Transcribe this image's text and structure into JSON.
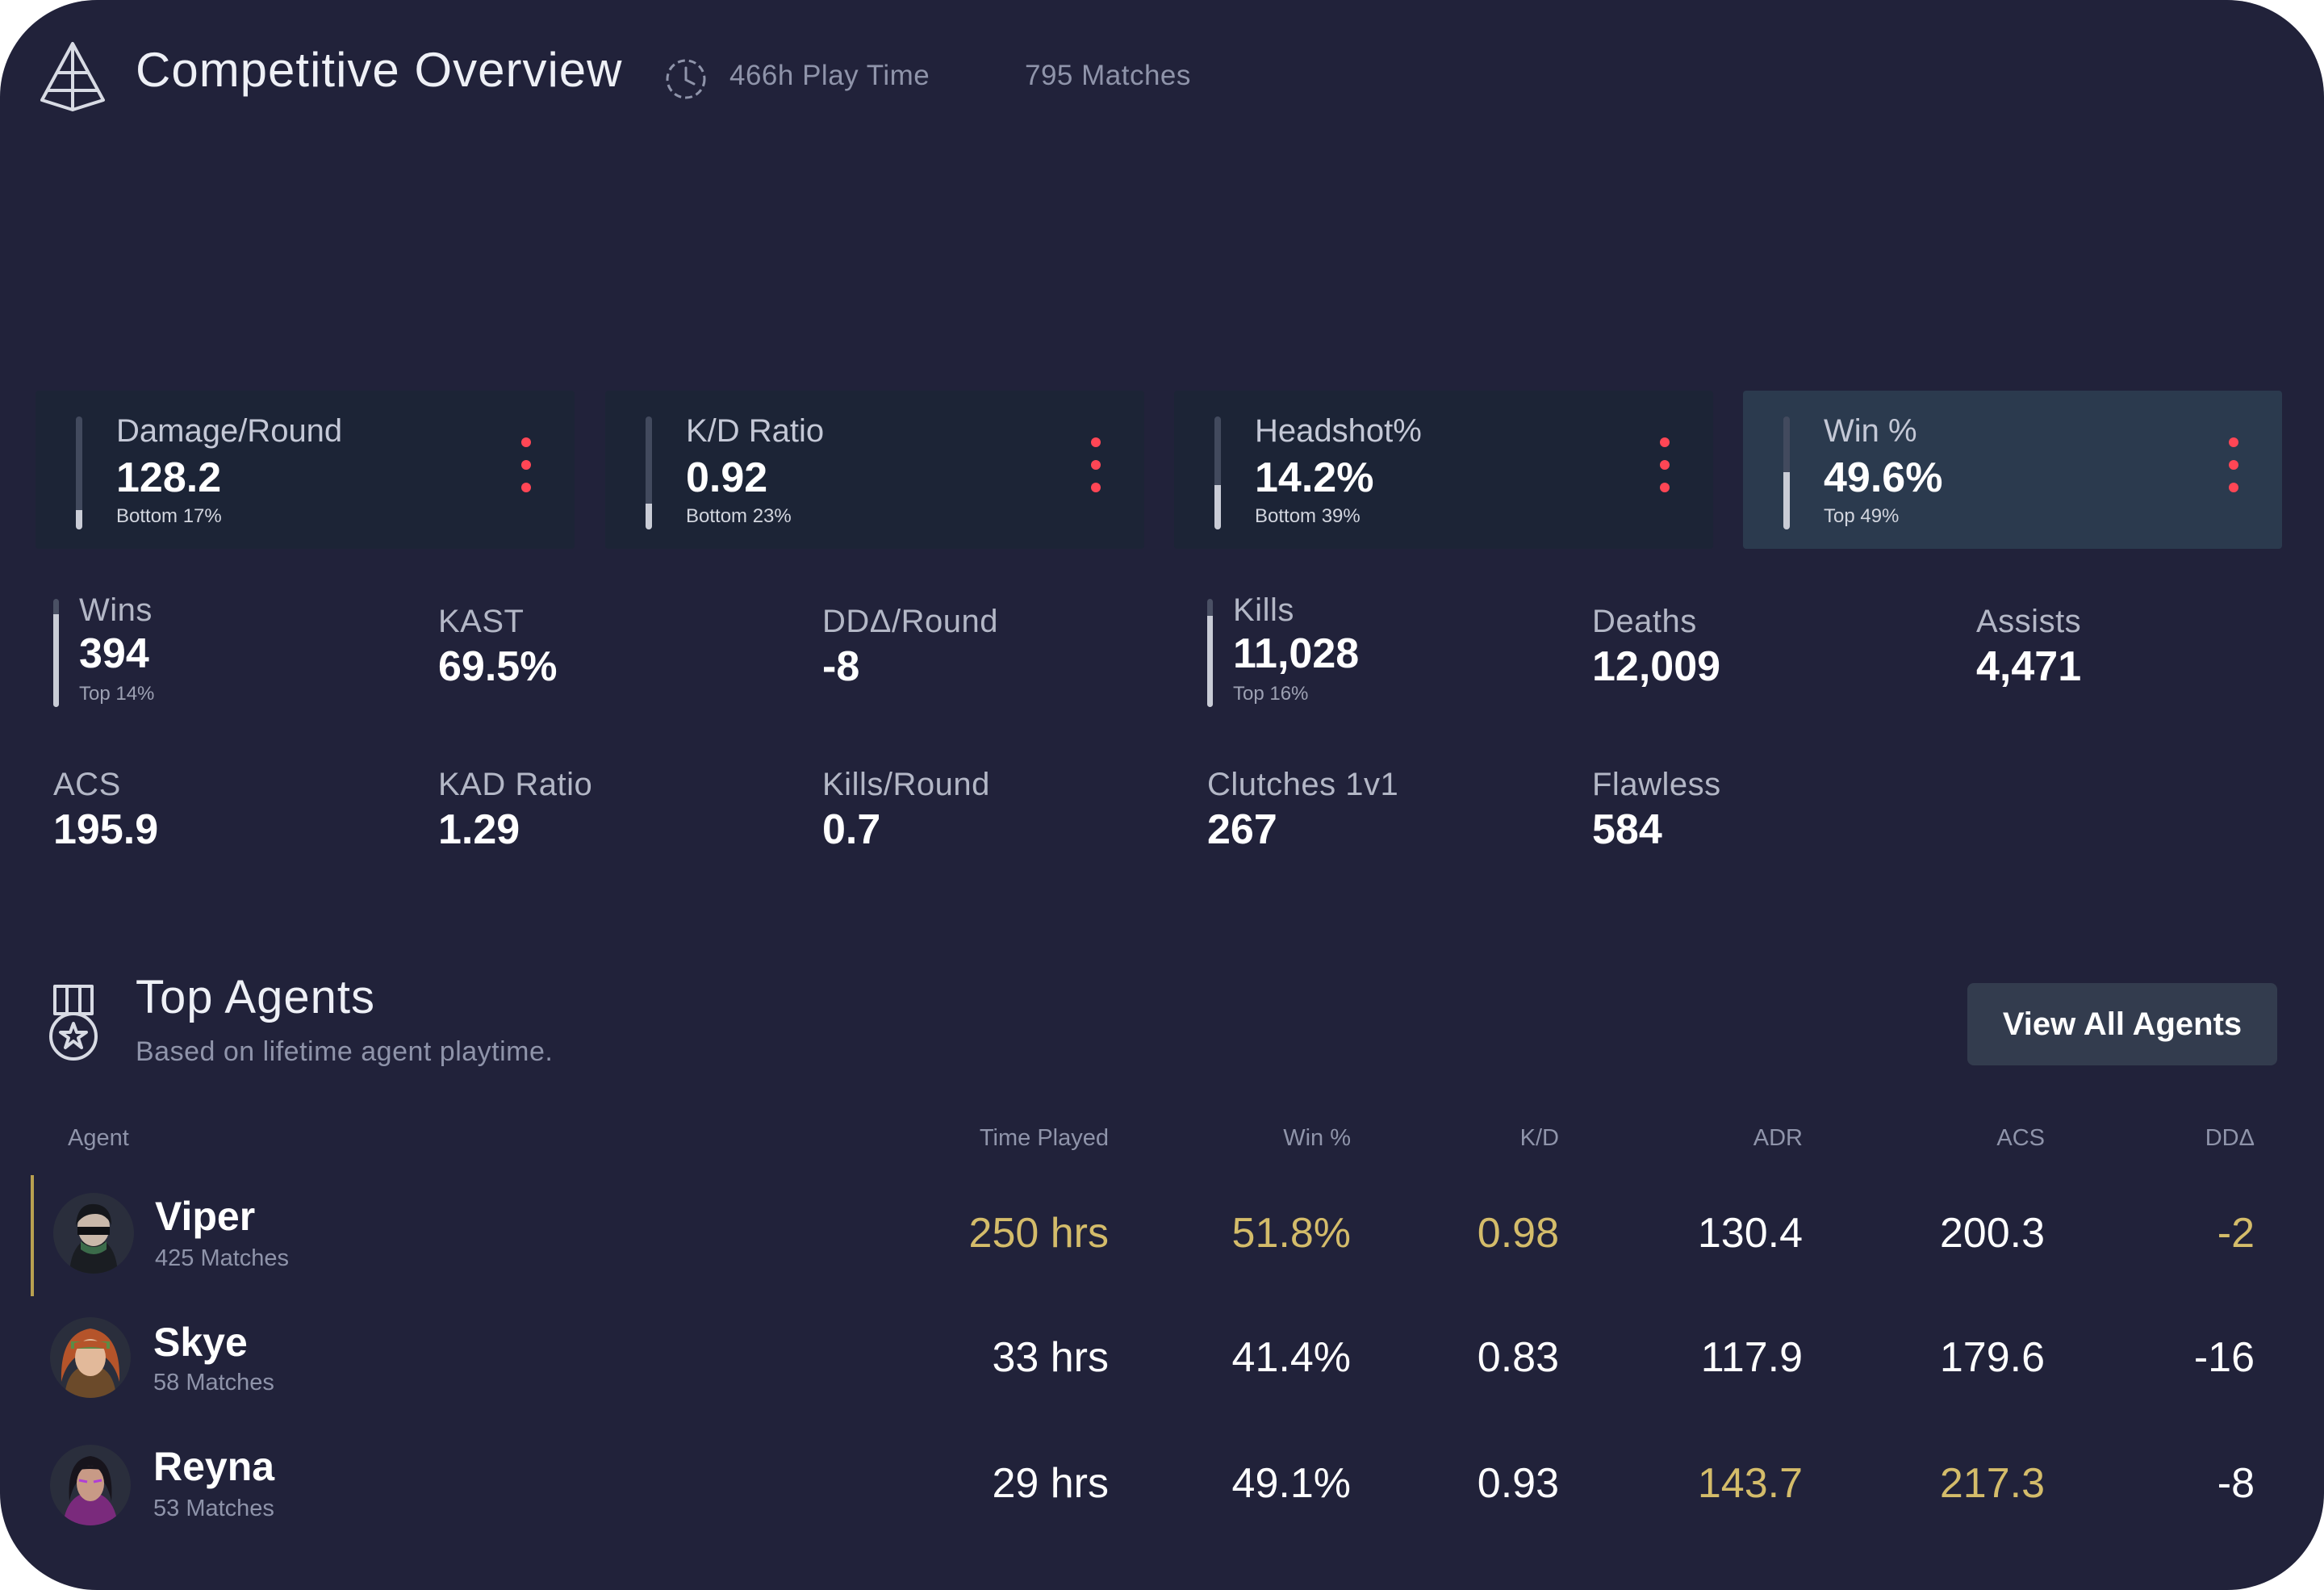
{
  "header": {
    "title": "Competitive Overview",
    "play_time": "466h Play Time",
    "matches": "795 Matches"
  },
  "top_stats": [
    {
      "label": "Damage/Round",
      "value": "128.2",
      "sub": "Bottom 17%",
      "level": 0.17
    },
    {
      "label": "K/D Ratio",
      "value": "0.92",
      "sub": "Bottom 23%",
      "level": 0.23
    },
    {
      "label": "Headshot%",
      "value": "14.2%",
      "sub": "Bottom 39%",
      "level": 0.39
    },
    {
      "label": "Win %",
      "value": "49.6%",
      "sub": "Top 49%",
      "level": 0.51
    }
  ],
  "stats": [
    {
      "label": "Wins",
      "value": "394",
      "sub": "Top 14%",
      "level": 0.86
    },
    {
      "label": "KAST",
      "value": "69.5%"
    },
    {
      "label": "DDΔ/Round",
      "value": "-8"
    },
    {
      "label": "Kills",
      "value": "11,028",
      "sub": "Top 16%",
      "level": 0.84
    },
    {
      "label": "Deaths",
      "value": "12,009"
    },
    {
      "label": "Assists",
      "value": "4,471"
    },
    {
      "label": "ACS",
      "value": "195.9"
    },
    {
      "label": "KAD Ratio",
      "value": "1.29"
    },
    {
      "label": "Kills/Round",
      "value": "0.7"
    },
    {
      "label": "Clutches 1v1",
      "value": "267"
    },
    {
      "label": "Flawless",
      "value": "584"
    }
  ],
  "top_agents": {
    "title": "Top Agents",
    "subtitle": "Based on lifetime agent playtime.",
    "view_all_label": "View All Agents",
    "columns": [
      "Agent",
      "Time Played",
      "Win %",
      "K/D",
      "ADR",
      "ACS",
      "DDΔ"
    ],
    "rows": [
      {
        "name": "Viper",
        "matches": "425 Matches",
        "cells": [
          "250 hrs",
          "51.8%",
          "0.98",
          "130.4",
          "200.3",
          "-2"
        ]
      },
      {
        "name": "Skye",
        "matches": "58 Matches",
        "cells": [
          "33 hrs",
          "41.4%",
          "0.83",
          "117.9",
          "179.6",
          "-16"
        ]
      },
      {
        "name": "Reyna",
        "matches": "53 Matches",
        "cells": [
          "29 hrs",
          "49.1%",
          "0.93",
          "143.7",
          "217.3",
          "-8"
        ]
      }
    ]
  },
  "colors": {
    "background": "#21223a",
    "card": "#1c2436",
    "card_active": "#2b3a4e",
    "accent_red": "#ff4655",
    "highlight_gold": "#d4bc6a"
  }
}
